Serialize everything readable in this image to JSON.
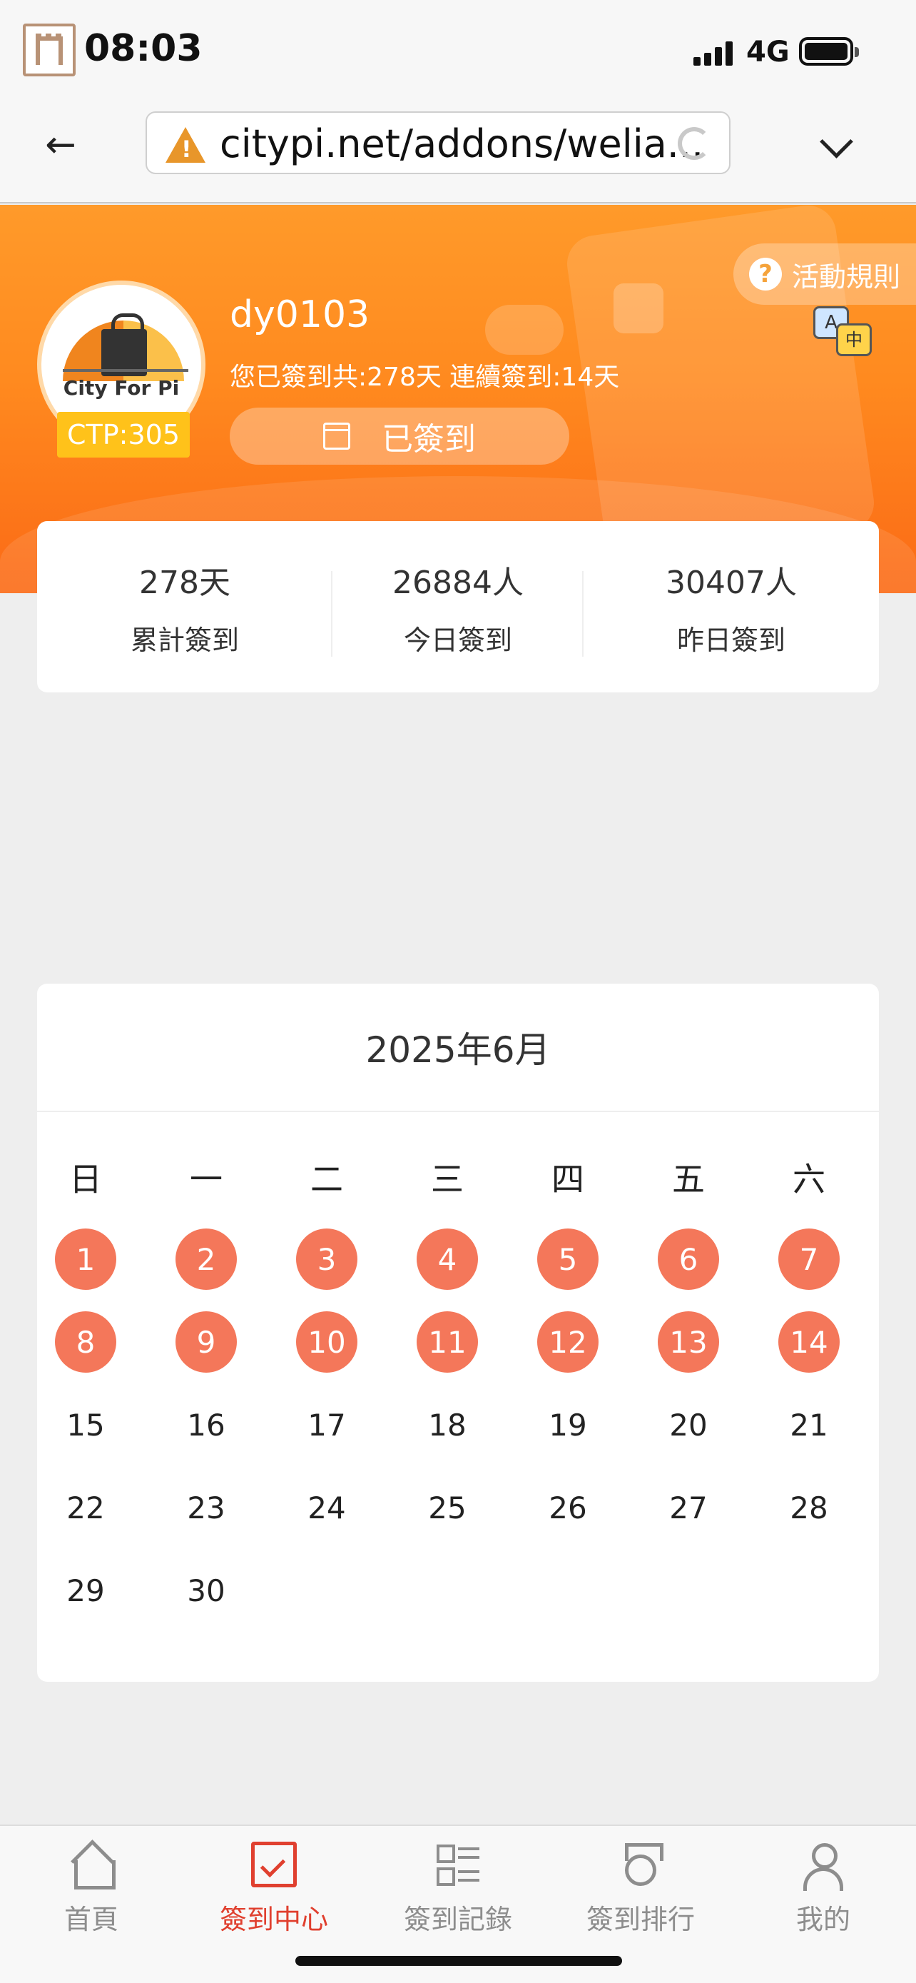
{
  "status_bar": {
    "time": "08:03",
    "network": "4G"
  },
  "browser": {
    "url": "citypi.net/addons/welia..."
  },
  "profile": {
    "avatar_text": "City For Pi",
    "ctp": "CTP:305",
    "username": "dy0103",
    "summary": "您已簽到共:278天 連續簽到:14天",
    "signed_label": "已簽到"
  },
  "rules": {
    "label": "活動規則",
    "icon_q": "?",
    "translate_a": "A",
    "translate_zh": "中"
  },
  "stats": [
    {
      "value": "278天",
      "label": "累計簽到"
    },
    {
      "value": "26884人",
      "label": "今日簽到"
    },
    {
      "value": "30407人",
      "label": "昨日簽到"
    }
  ],
  "calendar": {
    "title": "2025年6月",
    "weekdays": [
      "日",
      "一",
      "二",
      "三",
      "四",
      "五",
      "六"
    ],
    "days": [
      "1",
      "2",
      "3",
      "4",
      "5",
      "6",
      "7",
      "8",
      "9",
      "10",
      "11",
      "12",
      "13",
      "14",
      "15",
      "16",
      "17",
      "18",
      "19",
      "20",
      "21",
      "22",
      "23",
      "24",
      "25",
      "26",
      "27",
      "28",
      "29",
      "30"
    ],
    "signed_through": 14
  },
  "tabs": [
    {
      "label": "首頁",
      "icon": "home-icon"
    },
    {
      "label": "簽到中心",
      "icon": "checkin-icon",
      "active": true
    },
    {
      "label": "簽到記錄",
      "icon": "list-icon"
    },
    {
      "label": "簽到排行",
      "icon": "medal-icon"
    },
    {
      "label": "我的",
      "icon": "user-icon"
    }
  ],
  "colors": {
    "accent": "#f4775a",
    "brand_orange": "#ff8a1f",
    "active_tab": "#e0402f"
  }
}
